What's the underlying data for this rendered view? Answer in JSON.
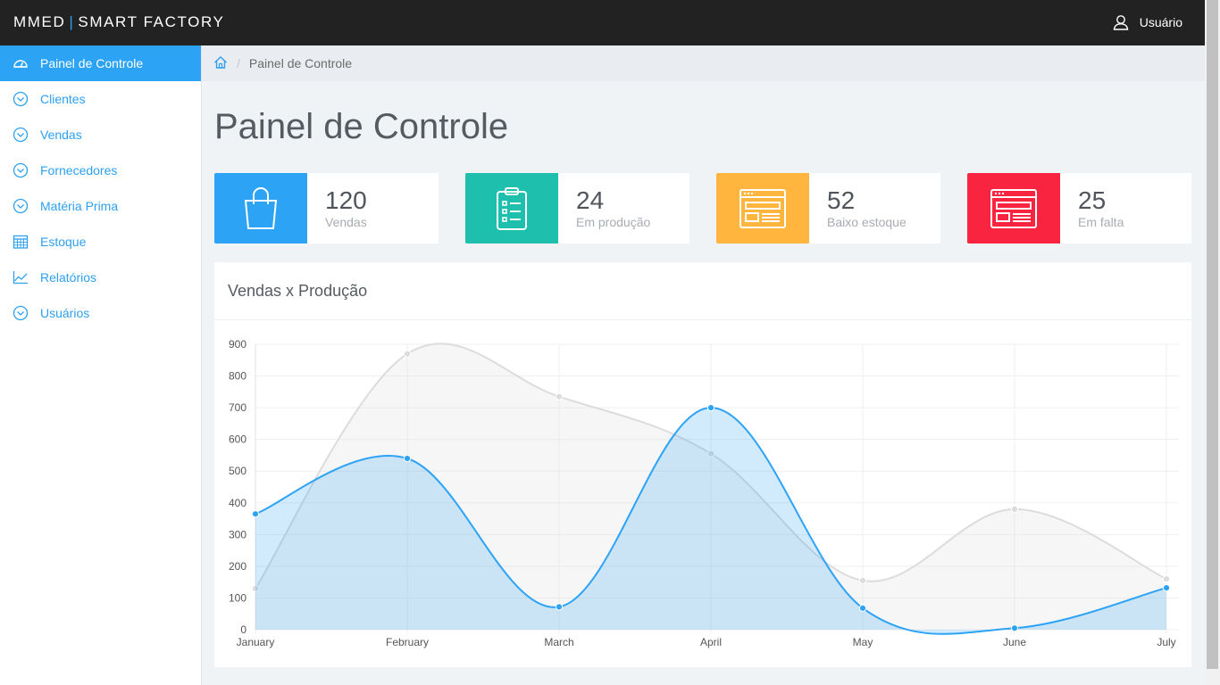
{
  "header": {
    "brand_left": "MMED",
    "brand_sep": "|",
    "brand_right": "SMART FACTORY",
    "user_label": "Usuário"
  },
  "sidebar": {
    "items": [
      {
        "label": "Painel de Controle",
        "icon": "dashboard-icon",
        "active": true
      },
      {
        "label": "Clientes",
        "icon": "chevron-circle-icon"
      },
      {
        "label": "Vendas",
        "icon": "chevron-circle-icon"
      },
      {
        "label": "Fornecedores",
        "icon": "chevron-circle-icon"
      },
      {
        "label": "Matéria Prima",
        "icon": "chevron-circle-icon"
      },
      {
        "label": "Estoque",
        "icon": "calendar-icon"
      },
      {
        "label": "Relatórios",
        "icon": "line-chart-icon"
      },
      {
        "label": "Usuários",
        "icon": "chevron-circle-icon"
      }
    ]
  },
  "breadcrumb": {
    "home_icon": "home-icon",
    "current": "Painel de Controle"
  },
  "main": {
    "title": "Painel de Controle"
  },
  "cards": [
    {
      "value": "120",
      "label": "Vendas",
      "color": "#2da3f5",
      "icon": "shopping-bag-icon"
    },
    {
      "value": "24",
      "label": "Em produção",
      "color": "#1fbfae",
      "icon": "clipboard-icon"
    },
    {
      "value": "52",
      "label": "Baixo estoque",
      "color": "#ffb53e",
      "icon": "browser-window-icon"
    },
    {
      "value": "25",
      "label": "Em falta",
      "color": "#f9243f",
      "icon": "browser-window-icon"
    }
  ],
  "chart_title": "Vendas x Produção",
  "chart_data": {
    "type": "area",
    "categories": [
      "January",
      "February",
      "March",
      "April",
      "May",
      "June",
      "July"
    ],
    "ylim": [
      0,
      900
    ],
    "yticks": [
      0,
      100,
      200,
      300,
      400,
      500,
      600,
      700,
      800,
      900
    ],
    "grid": true,
    "series": [
      {
        "values": [
          130,
          870,
          735,
          555,
          155,
          380,
          160
        ],
        "color": "#dcdcdc"
      },
      {
        "values": [
          365,
          540,
          72,
          700,
          68,
          5,
          132
        ],
        "color": "#2da3f5"
      }
    ]
  }
}
